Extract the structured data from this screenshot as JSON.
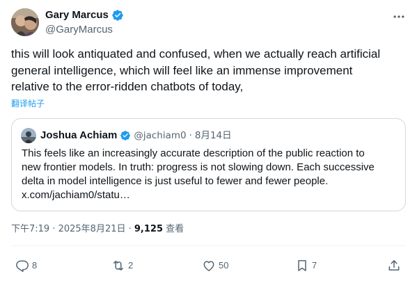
{
  "tweet": {
    "author_name": "Gary Marcus",
    "handle": "@GaryMarcus",
    "text": "this will look antiquated and confused, when we actually reach artificial\ngeneral intelligence, which will feel like an immense improvement\nrelative to the error-ridden chatbots of today,",
    "translate_label": "翻译帖子",
    "quoted": {
      "author_name": "Joshua Achiam",
      "handle": "@jachiam0",
      "separator": "·",
      "date": "8月14日",
      "text": "This feels like an increasingly accurate description of the public reaction to\nnew frontier models. In truth: progress is not slowing down. Each successive\ndelta in model intelligence is just useful to fewer and fewer people.\nx.com/jachiam0/statu…"
    },
    "timestamp": "下午7:19 · 2025年8月21日 · ",
    "views_count": "9,125",
    "views_label": " 查看"
  },
  "actions": {
    "reply_count": "8",
    "repost_count": "2",
    "like_count": "50",
    "bookmark_count": "7"
  },
  "icons": {
    "verified": "verified-badge-icon",
    "more": "more-dots-icon",
    "reply": "reply-icon",
    "repost": "repost-icon",
    "like": "heart-icon",
    "bookmark": "bookmark-icon",
    "share": "share-icon"
  },
  "colors": {
    "verified_blue": "#1d9bf0",
    "text_primary": "#0f1419",
    "text_secondary": "#536471",
    "border": "#cfd9de"
  }
}
